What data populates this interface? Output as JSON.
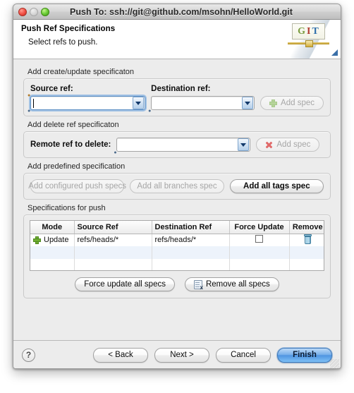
{
  "window": {
    "title": "Push To: ssh://git@github.com/msohn/HelloWorld.git",
    "close_icon": "close-traffic-light",
    "minimize_icon": "minimize-traffic-light",
    "zoom_icon": "zoom-traffic-light"
  },
  "wizard_header": {
    "title": "Push Ref Specifications",
    "subtitle": "Select refs to push.",
    "logo": {
      "g": "G",
      "i": "I",
      "t": "T"
    }
  },
  "create_update_group": {
    "label": "Add create/update specificaton",
    "source_ref_label": "Source ref:",
    "source_ref_value": "",
    "source_ref_placeholder": "",
    "destination_ref_label": "Destination ref:",
    "destination_ref_value": "",
    "destination_ref_placeholder": "",
    "add_spec_label": "Add spec"
  },
  "delete_group": {
    "label": "Add delete ref specificaton",
    "remote_ref_label": "Remote ref to delete:",
    "remote_ref_value": "",
    "remote_ref_placeholder": "",
    "add_spec_label": "Add spec"
  },
  "predefined_group": {
    "label": "Add predefined specification",
    "buttons": [
      {
        "label": "Add configured push specs",
        "enabled": false
      },
      {
        "label": "Add all branches spec",
        "enabled": false
      },
      {
        "label": "Add all tags spec",
        "enabled": true
      }
    ]
  },
  "specs_group": {
    "label": "Specifications for push",
    "columns": [
      "Mode",
      "Source Ref",
      "Destination Ref",
      "Force Update",
      "Remove"
    ],
    "rows": [
      {
        "mode": "Update",
        "mode_icon": "plus-icon",
        "source_ref": "refs/heads/*",
        "destination_ref": "refs/heads/*",
        "force_update": false,
        "remove_icon": "trash-icon"
      }
    ],
    "force_update_all_label": "Force update all specs",
    "remove_all_label": "Remove all specs"
  },
  "footer": {
    "help_label": "?",
    "back_label": "< Back",
    "next_label": "Next >",
    "cancel_label": "Cancel",
    "finish_label": "Finish"
  },
  "colors": {
    "accent_blue": "#4f95e2",
    "window_bg": "#ececec",
    "panel_white": "#ffffff",
    "row_alt": "#edf3fb",
    "plus_green": "#6fae33",
    "x_red": "#e06a6a",
    "trash_blue": "#6aa8c8"
  }
}
